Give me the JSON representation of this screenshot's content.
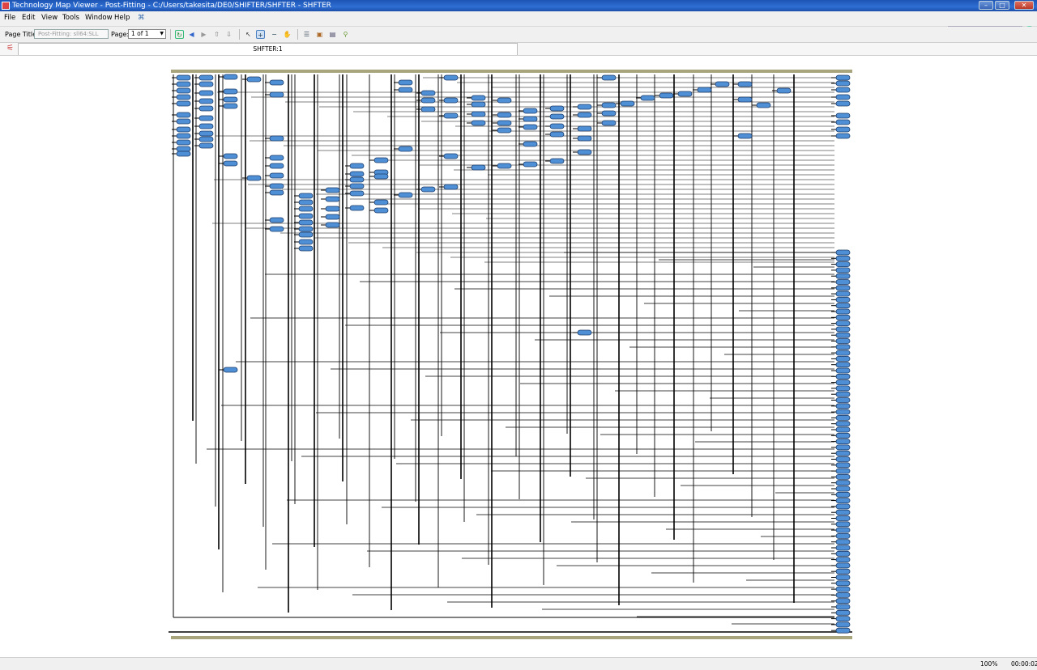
{
  "window": {
    "title": "Technology Map Viewer - Post-Fitting - C:/Users/takesita/DE0/SHIFTER/SHFTER - SHFTER"
  },
  "menubar": {
    "items": [
      {
        "label": "File",
        "key": "F"
      },
      {
        "label": "Edit",
        "key": "E"
      },
      {
        "label": "View",
        "key": "V"
      },
      {
        "label": "Tools",
        "key": "T"
      },
      {
        "label": "Window",
        "key": "W"
      },
      {
        "label": "Help",
        "key": "H"
      }
    ],
    "search_placeholder": "Search altera.com"
  },
  "toolbar": {
    "page_title_label": "Page Title:",
    "page_title_value": "Post-Fitting: sll64:SLL",
    "page_label": "Page:",
    "page_value": "1 of 1"
  },
  "tab": {
    "label": "SHFTER:1"
  },
  "status": {
    "zoom": "100%",
    "time": "00:00:02"
  },
  "colors": {
    "titlebar": "#2f6fd3",
    "node_fill": "#4f8fd6",
    "frame": "#a8a47c"
  },
  "icons": [
    "app-icon",
    "minimize-icon",
    "maximize-icon",
    "close-icon",
    "globe-icon",
    "help-cursor-icon",
    "refresh-icon",
    "back-icon",
    "forward-icon",
    "select-icon",
    "zoom-in-icon",
    "zoom-out-icon",
    "hand-icon",
    "hierarchy-icon",
    "export-icon",
    "settings-icon",
    "search-icon"
  ]
}
